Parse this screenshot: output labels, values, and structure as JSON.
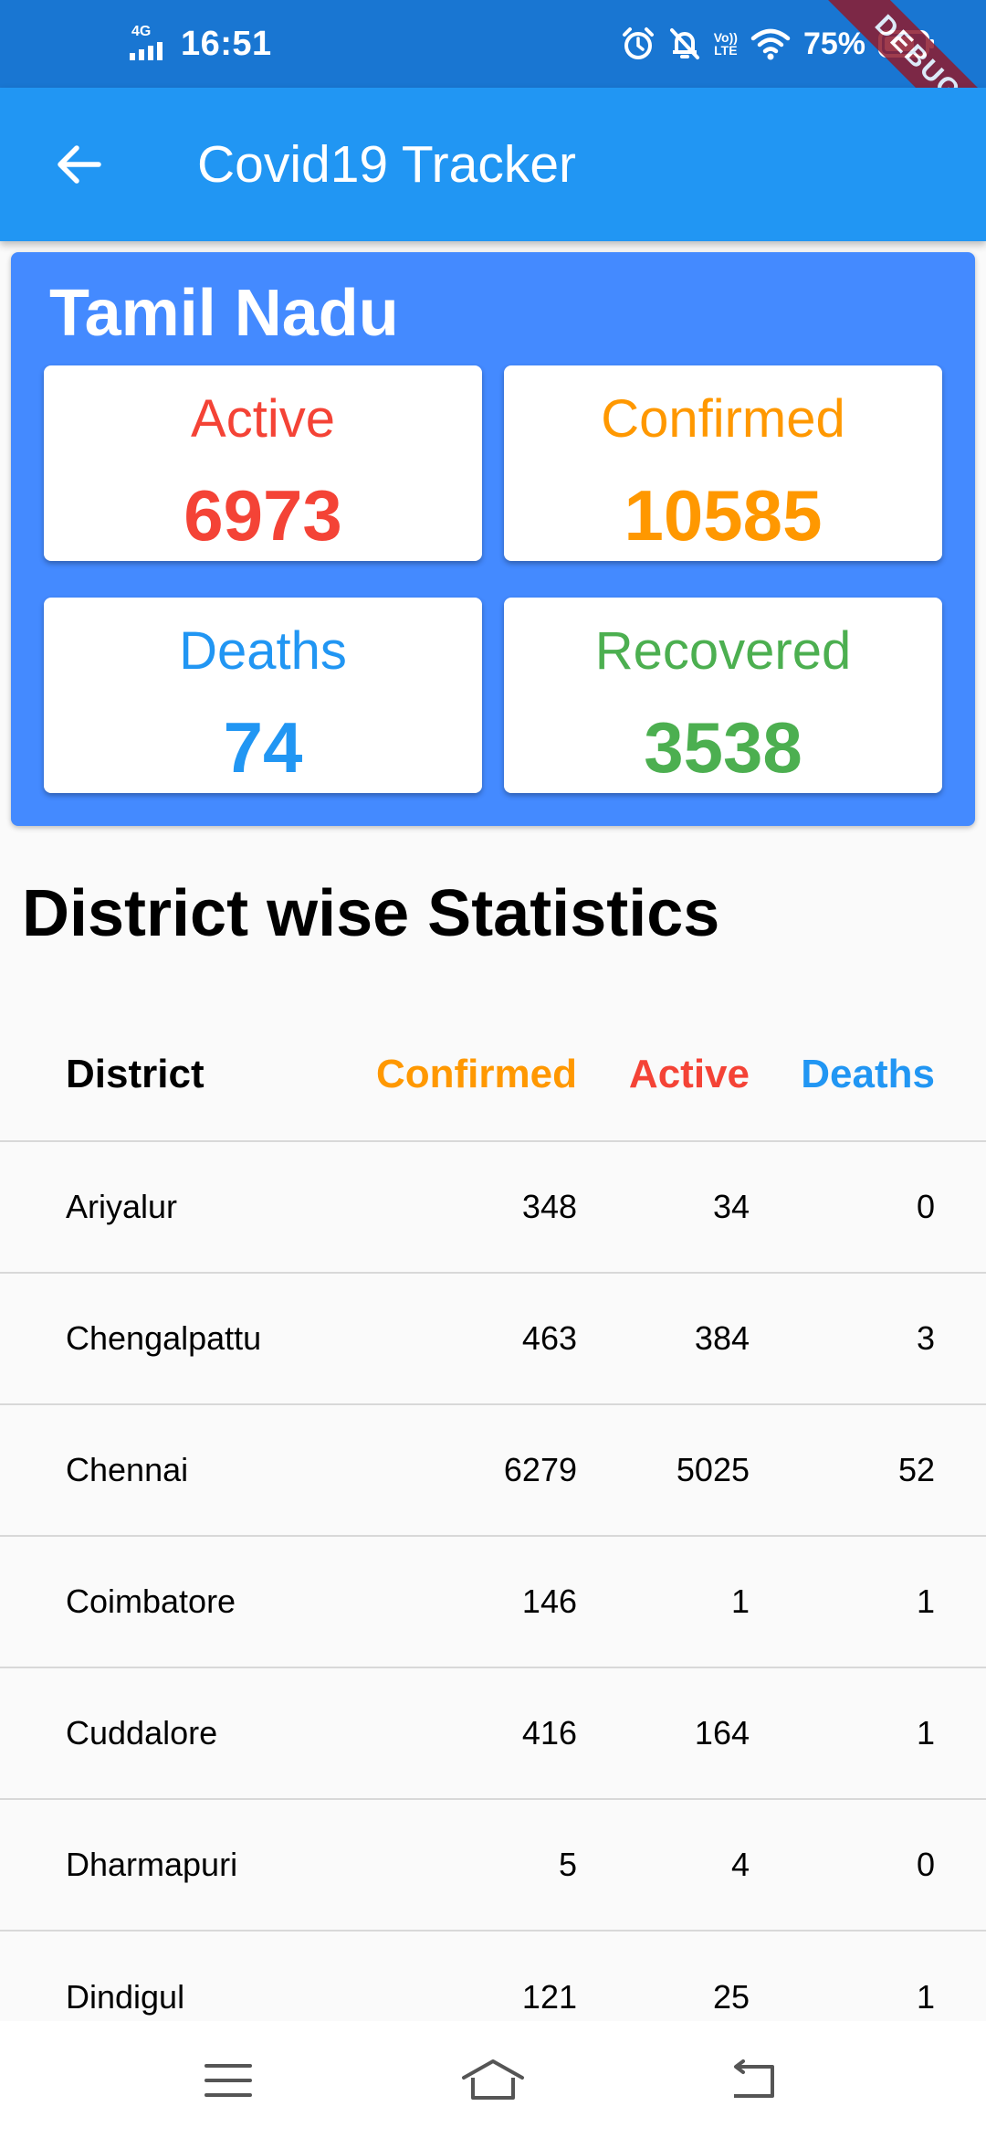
{
  "status_bar": {
    "network": "4G",
    "time": "16:51",
    "volte_top": "Vo))",
    "volte_bottom": "LTE",
    "battery_percent": "75%",
    "battery_level": 0.75,
    "debug_banner": "DEBUG"
  },
  "app_bar": {
    "title": "Covid19 Tracker",
    "back_icon": "arrow-back-icon"
  },
  "state_summary": {
    "name": "Tamil Nadu",
    "active_label": "Active",
    "active_value": "6973",
    "confirmed_label": "Confirmed",
    "confirmed_value": "10585",
    "deaths_label": "Deaths",
    "deaths_value": "74",
    "recovered_label": "Recovered",
    "recovered_value": "3538"
  },
  "district_section": {
    "title": "District wise Statistics",
    "headers": {
      "district": "District",
      "confirmed": "Confirmed",
      "active": "Active",
      "deaths": "Deaths"
    },
    "rows": [
      {
        "district": "Ariyalur",
        "confirmed": "348",
        "active": "34",
        "deaths": "0"
      },
      {
        "district": "Chengalpattu",
        "confirmed": "463",
        "active": "384",
        "deaths": "3"
      },
      {
        "district": "Chennai",
        "confirmed": "6279",
        "active": "5025",
        "deaths": "52"
      },
      {
        "district": "Coimbatore",
        "confirmed": "146",
        "active": "1",
        "deaths": "1"
      },
      {
        "district": "Cuddalore",
        "confirmed": "416",
        "active": "164",
        "deaths": "1"
      },
      {
        "district": "Dharmapuri",
        "confirmed": "5",
        "active": "4",
        "deaths": "0"
      },
      {
        "district": "Dindigul",
        "confirmed": "121",
        "active": "25",
        "deaths": "1"
      }
    ]
  },
  "colors": {
    "app_bar": "#2196f3",
    "status_bar": "#1976d2",
    "card": "#448aff",
    "active": "#f44336",
    "confirmed": "#ff9800",
    "deaths": "#2196f3",
    "recovered": "#4caf50"
  },
  "nav_bar": {
    "menu_icon": "menu-icon",
    "home_icon": "home-icon",
    "back_icon": "back-icon"
  }
}
